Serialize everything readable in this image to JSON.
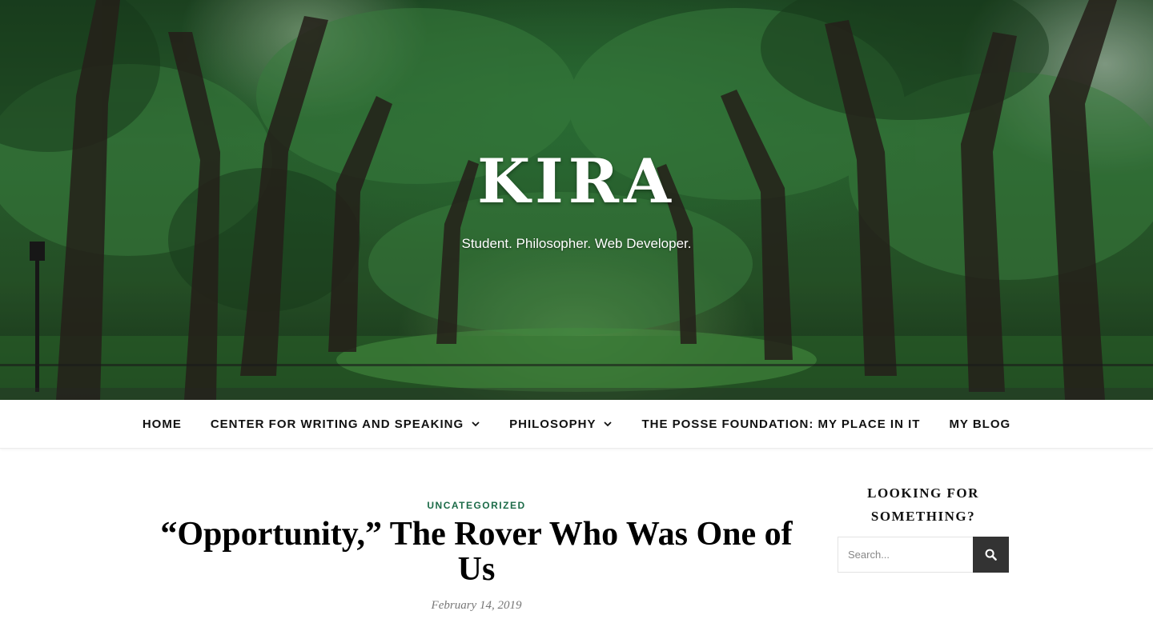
{
  "site": {
    "title": "KIRA",
    "tagline": "Student. Philosopher. Web Developer."
  },
  "nav": {
    "items": [
      {
        "label": "HOME",
        "has_dropdown": false
      },
      {
        "label": "CENTER FOR WRITING AND SPEAKING",
        "has_dropdown": true
      },
      {
        "label": "PHILOSOPHY",
        "has_dropdown": true
      },
      {
        "label": "THE POSSE FOUNDATION: MY PLACE IN IT",
        "has_dropdown": false
      },
      {
        "label": "MY BLOG",
        "has_dropdown": false
      }
    ],
    "dropdown_icon": "chevron-down-icon"
  },
  "post": {
    "category": "UNCATEGORIZED",
    "title": "“Opportunity,” The Rover Who Was One of Us",
    "date": "February 14, 2019"
  },
  "sidebar": {
    "widget_title": "LOOKING FOR SOMETHING?",
    "search": {
      "placeholder": "Search...",
      "value": "",
      "button_icon": "search-icon"
    }
  },
  "colors": {
    "accent": "#1c6b48",
    "search_button": "#333333",
    "text": "#111111",
    "date": "#777777"
  }
}
